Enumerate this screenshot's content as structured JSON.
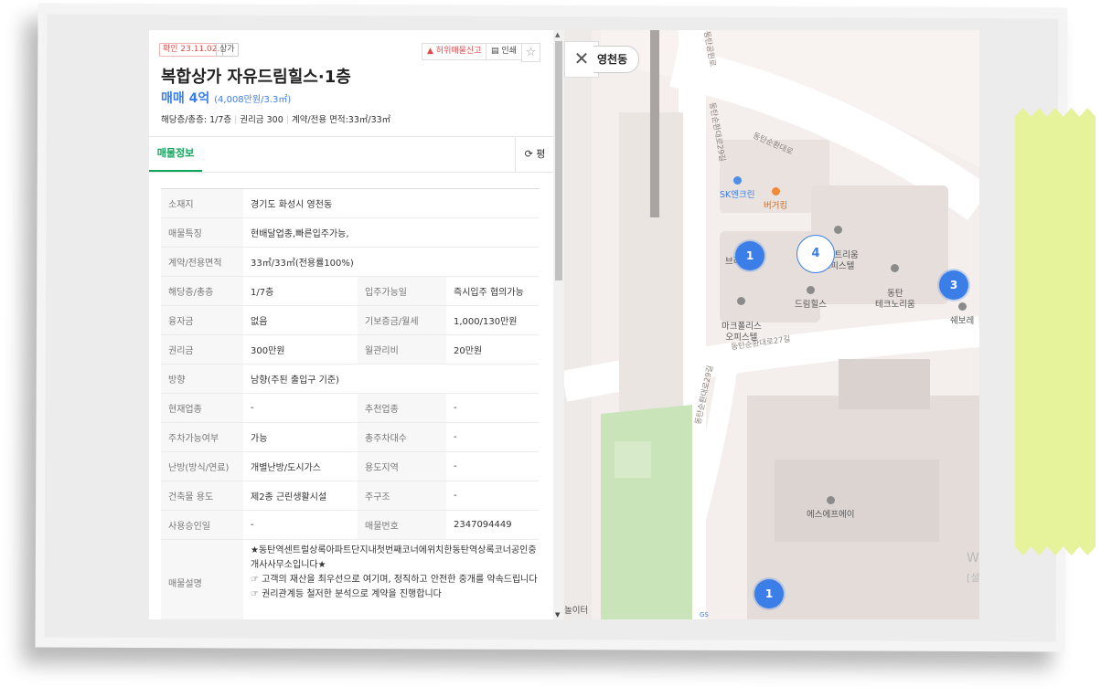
{
  "listing": {
    "date_tag": "확인 23.11.02.",
    "type_tag": "상가",
    "report_label": "허위매물신고",
    "print_label": "인쇄",
    "star_icon": "star-icon",
    "title": "복합상가 자유드림힐스·1층",
    "price_main": "매매 4억",
    "price_sub": "(4,008만원/3.3㎡)",
    "summary": {
      "floor": "해당층/총층: 1/7층",
      "premium": "권리금 300",
      "area": "계약/전용 면적:33㎡/33㎡"
    }
  },
  "tabs": {
    "info_label": "매물정보",
    "toggle_label": "평",
    "toggle_icon": "refresh-icon"
  },
  "details": [
    {
      "k1": "소재지",
      "v1": "경기도 화성시 영천동"
    },
    {
      "k1": "매물특징",
      "v1": "현배달업종,빠른입주가능,"
    },
    {
      "k1": "계약/전용면적",
      "v1": "33㎡/33㎡(전용률100%)"
    },
    {
      "k1": "해당층/총층",
      "v1": "1/7층",
      "k2": "입주가능일",
      "v2": "즉시입주 협의가능"
    },
    {
      "k1": "융자금",
      "v1": "없음",
      "k2": "기보증금/월세",
      "v2": "1,000/130만원"
    },
    {
      "k1": "권리금",
      "v1": "300만원",
      "k2": "월관리비",
      "v2": "20만원"
    },
    {
      "k1": "방향",
      "v1": "남향(주된 출입구 기준)"
    },
    {
      "k1": "현재업종",
      "v1": "-",
      "k2": "추천업종",
      "v2": "-"
    },
    {
      "k1": "주차가능여부",
      "v1": "가능",
      "k2": "총주차대수",
      "v2": "-"
    },
    {
      "k1": "난방(방식/연료)",
      "v1": "개별난방/도시가스",
      "k2": "용도지역",
      "v2": "-"
    },
    {
      "k1": "건축물 용도",
      "v1": "제2종 근린생활시설",
      "k2": "주구조",
      "v2": "-"
    },
    {
      "k1": "사용승인일",
      "v1": "-",
      "k2": "매물번호",
      "v2": "2347094449"
    }
  ],
  "description": {
    "label": "매물설명",
    "text": "★동탄역센트럴상록아파트단지내첫번째코너에위치한동탄역상록코너공인중개사사무소입니다★\n☞ 고객의 재산을 최우선으로 여기며, 정직하고 안전한 중개를 약속드립니다\n☞ 권리관계등 철저한 분석으로 계약을 진행합니다"
  },
  "map": {
    "close_icon": "close-icon",
    "region_label": "영천동",
    "clusters": [
      "1",
      "4",
      "3",
      "1"
    ],
    "pois": {
      "sk": "SK엔크린",
      "burger": "버거킹",
      "smartrium": "스마트리움\n오피스텔",
      "techno": "동탄\n테크노리움",
      "marc": "마크폴리스\n오피스텔",
      "dream": "드림힐스",
      "brand": "브리",
      "sfa": "에스에프에이",
      "shebo": "쉐보레",
      "w": "W",
      "seol": "[설",
      "noiter": "놀이터",
      "gs": "GS"
    },
    "streets": {
      "s1": "동탄순환대로",
      "s2": "동탄순환대로29길",
      "s3": "동탄순환대로27길",
      "s4": "동탄순환대로29길",
      "s5": "동탄공원로"
    }
  }
}
